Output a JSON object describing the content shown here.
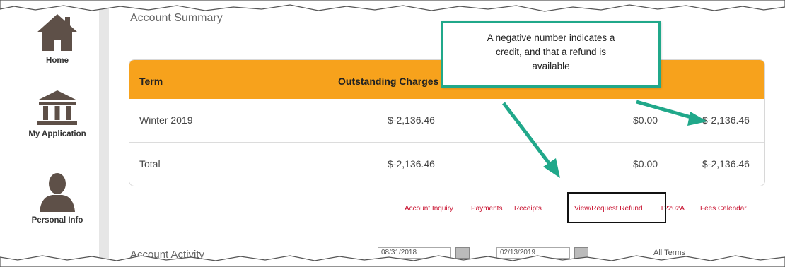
{
  "sidebar": {
    "items": [
      {
        "label": "Home",
        "icon": "home-icon"
      },
      {
        "label": "My Application",
        "icon": "institution-icon"
      },
      {
        "label": "Personal Info",
        "icon": "person-icon"
      }
    ]
  },
  "account_summary": {
    "title": "Account Summary",
    "headers": [
      "Term",
      "Outstanding Charges"
    ],
    "rows": [
      {
        "term": "Winter 2019",
        "outstanding": "$-2,136.46",
        "col3": "$0.00",
        "col4": "$-2,136.46"
      },
      {
        "term": "Total",
        "outstanding": "$-2,136.46",
        "col3": "$0.00",
        "col4": "$-2,136.46"
      }
    ],
    "header_color": "#f7a21c"
  },
  "links": [
    "Account Inquiry",
    "Payments",
    "Receipts",
    "View/Request Refund",
    "T2202A",
    "Fees Calendar"
  ],
  "callout": {
    "line1": "A negative number indicates a",
    "line2": "credit, and that a refund is",
    "line3": "available",
    "border_color": "#20a88a"
  },
  "activity": {
    "title": "Account Activity",
    "from_date": "08/31/2018",
    "to_date": "02/13/2019",
    "filter_label": "All Terms"
  },
  "colors": {
    "link": "#c8102e",
    "accent_arrow": "#20a88a"
  }
}
